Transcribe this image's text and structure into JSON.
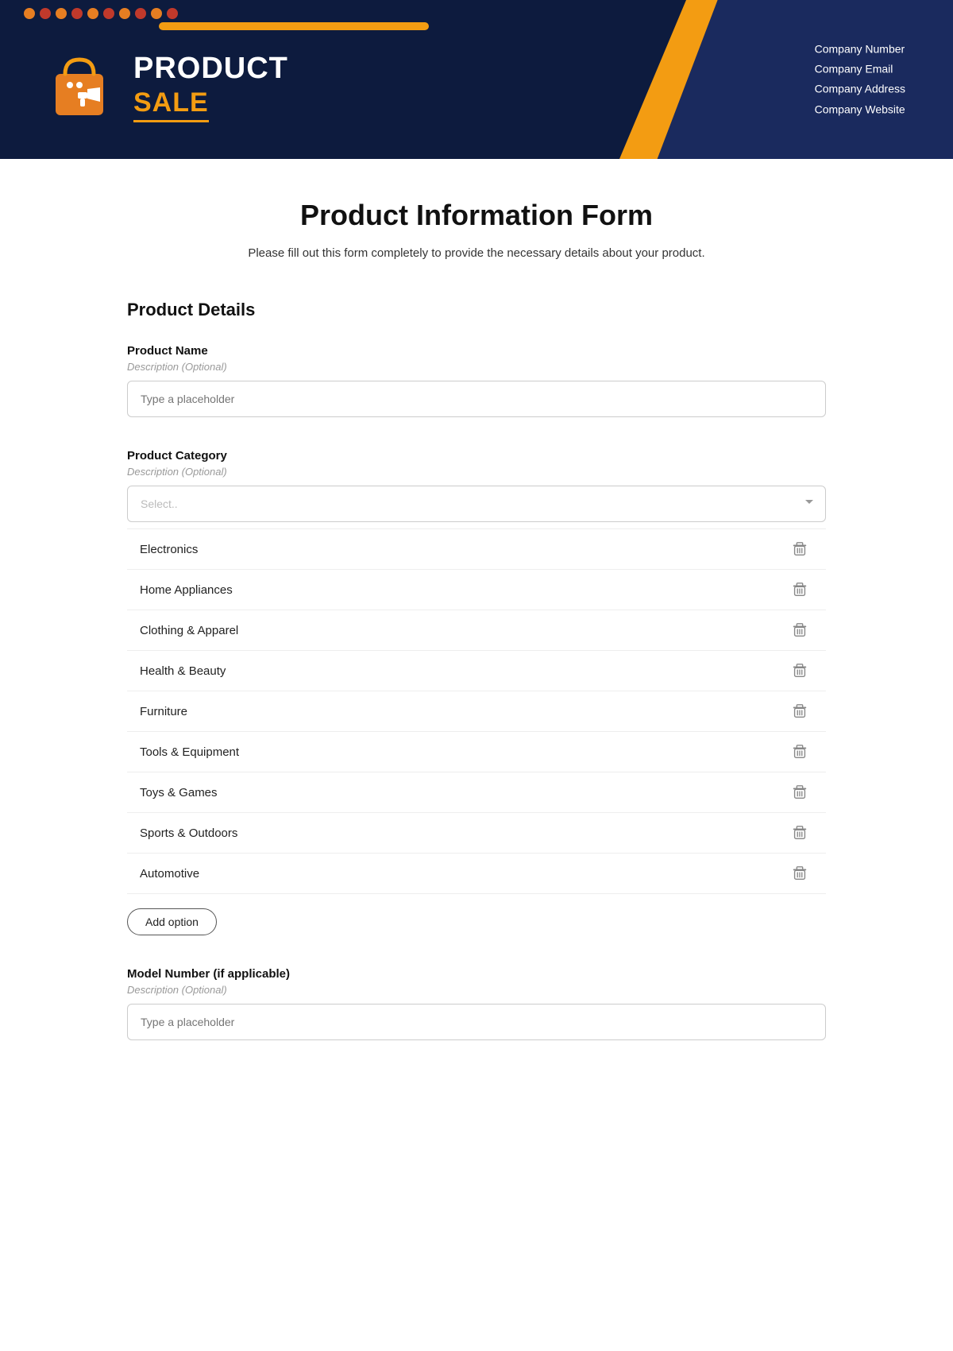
{
  "header": {
    "logo_text": "PRODUCT",
    "logo_sale": "SALE",
    "company_info": [
      "Company Number",
      "Company Email",
      "Company Address",
      "Company Website"
    ],
    "dots_count": 10
  },
  "form": {
    "title": "Product Information Form",
    "description": "Please fill out this form completely to provide the necessary details about your product.",
    "section_title": "Product Details",
    "fields": {
      "product_name": {
        "label": "Product Name",
        "description": "Description (Optional)",
        "placeholder": "Type a placeholder"
      },
      "product_category": {
        "label": "Product Category",
        "description": "Description (Optional)",
        "placeholder": "Select..",
        "options": [
          "Electronics",
          "Home Appliances",
          "Clothing & Apparel",
          "Health & Beauty",
          "Furniture",
          "Tools & Equipment",
          "Toys & Games",
          "Sports & Outdoors",
          "Automotive"
        ],
        "add_option_label": "Add option"
      },
      "model_number": {
        "label": "Model Number (if applicable)",
        "description": "Description (Optional)",
        "placeholder": "Type a placeholder"
      }
    }
  }
}
